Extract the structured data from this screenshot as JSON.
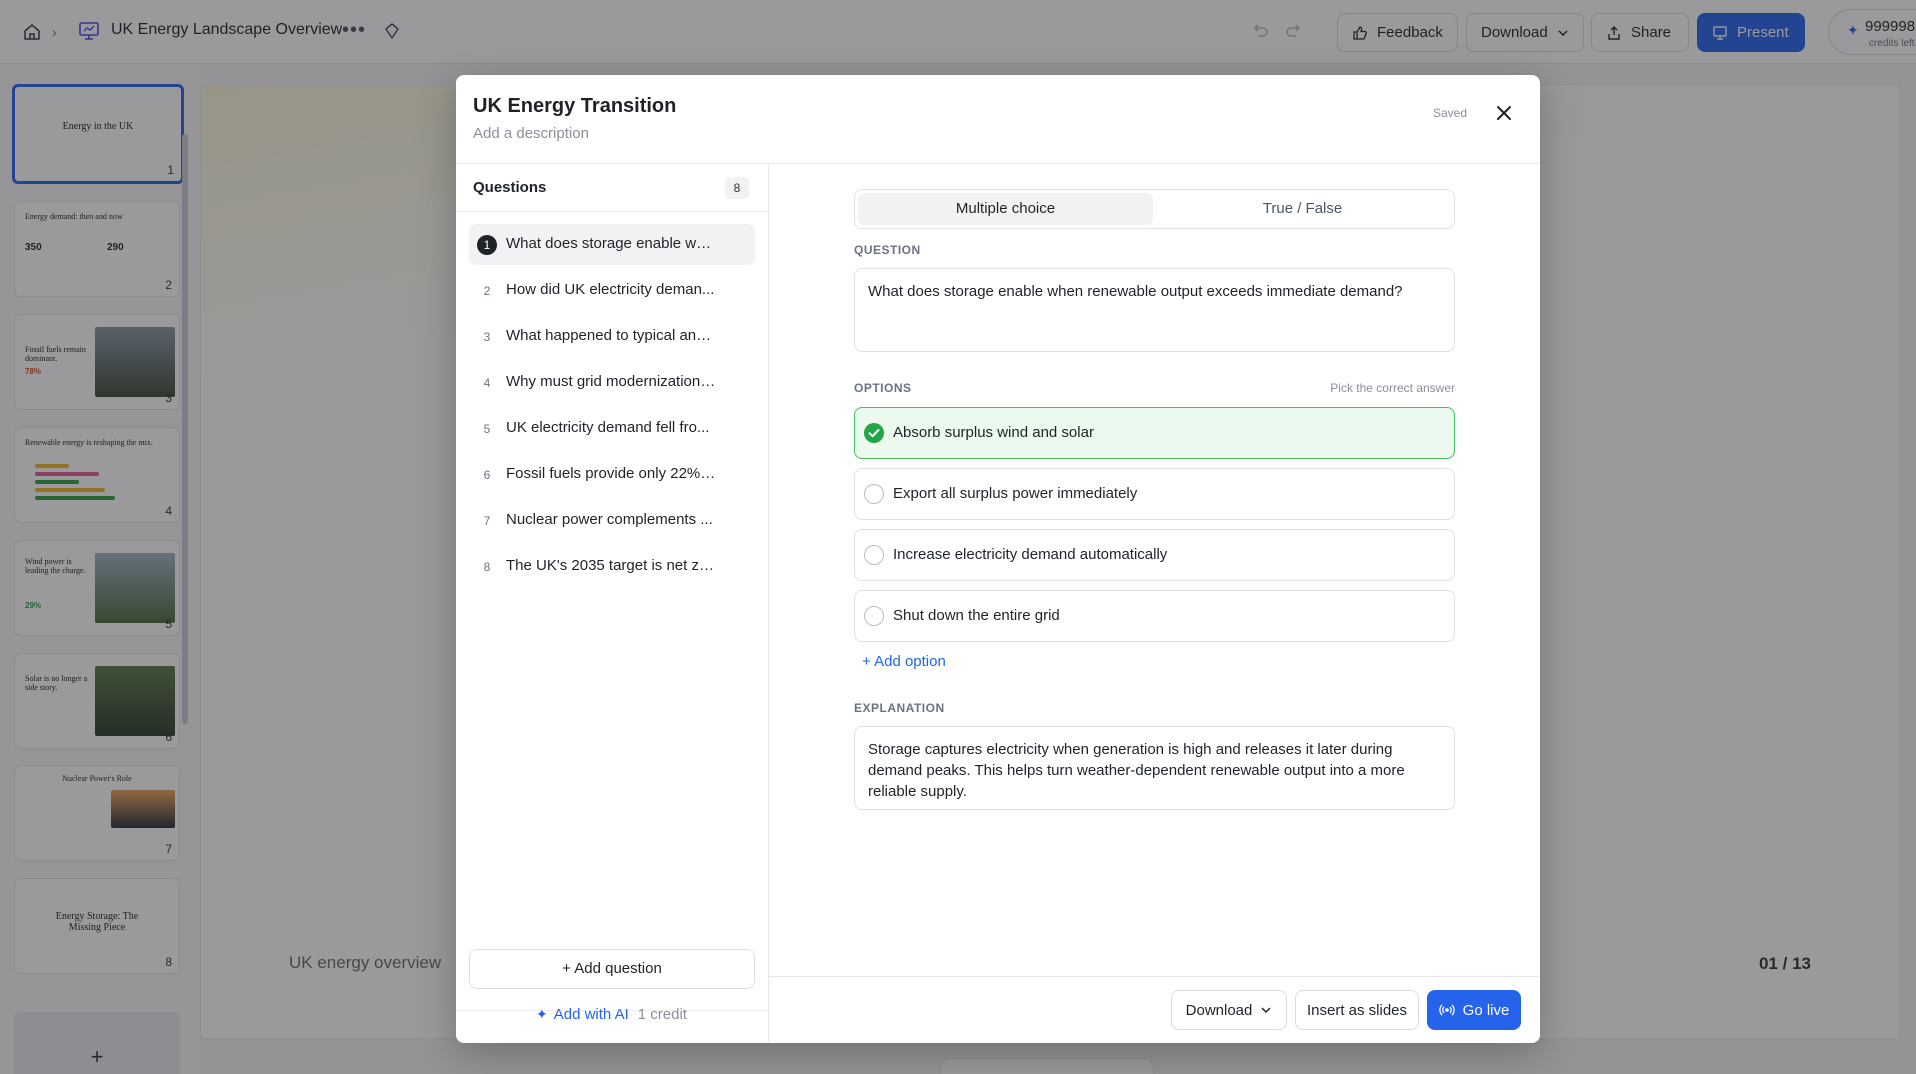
{
  "app": {
    "breadcrumb_doc_title": "UK Energy Landscape Overview",
    "toolbar": {
      "feedback_label": "Feedback",
      "download_label": "Download",
      "share_label": "Share",
      "present_label": "Present",
      "credits_value": "999998",
      "credits_label": "credits left"
    }
  },
  "thumbnails": [
    {
      "number": "1",
      "title": "Energy in the UK"
    },
    {
      "number": "2",
      "title": "Energy demand: then and now",
      "stat_a": "350",
      "stat_b": "290"
    },
    {
      "number": "3",
      "title": "Fossil fuels remain dominant.",
      "stat": "78%"
    },
    {
      "number": "4",
      "title": "Renewable energy is reshaping the mix."
    },
    {
      "number": "5",
      "title": "Wind power is leading the charge.",
      "stat": "29%"
    },
    {
      "number": "6",
      "title": "Solar is no longer a side story."
    },
    {
      "number": "7",
      "title": "Nuclear Power's Role"
    },
    {
      "number": "8",
      "title": "Energy Storage: The Missing Piece"
    }
  ],
  "canvas": {
    "footer_left": "UK energy overview",
    "page_indicator": "01 / 13"
  },
  "modal": {
    "title": "UK Energy Transition",
    "description_placeholder": "Add a description",
    "saved_status": "Saved",
    "questions_label": "Questions",
    "questions_count": "8",
    "questions": [
      {
        "number": "1",
        "text": "What does storage enable wh..."
      },
      {
        "number": "2",
        "text": "How did UK electricity deman..."
      },
      {
        "number": "3",
        "text": "What happened to typical ann..."
      },
      {
        "number": "4",
        "text": "Why must grid modernization ..."
      },
      {
        "number": "5",
        "text": "UK electricity demand fell fro..."
      },
      {
        "number": "6",
        "text": "Fossil fuels provide only 22% ..."
      },
      {
        "number": "7",
        "text": "Nuclear power complements ..."
      },
      {
        "number": "8",
        "text": "The UK's 2035 target is net ze..."
      }
    ],
    "add_question_label": "+ Add question",
    "add_with_ai_label": "Add with AI",
    "add_with_ai_cost": "1 credit",
    "type_tabs": {
      "multiple_choice": "Multiple choice",
      "true_false": "True / False"
    },
    "question_label": "QUESTION",
    "question_text": "What does storage enable when renewable output exceeds immediate demand?",
    "options_label": "OPTIONS",
    "options_hint": "Pick the correct answer",
    "options": [
      {
        "text": "Absorb surplus wind and solar",
        "correct": true
      },
      {
        "text": "Export all surplus power immediately",
        "correct": false
      },
      {
        "text": "Increase electricity demand automatically",
        "correct": false
      },
      {
        "text": "Shut down the entire grid",
        "correct": false
      }
    ],
    "add_option_label": "+ Add option",
    "explanation_label": "EXPLANATION",
    "explanation_text": "Storage captures electricity when generation is high and releases it later during demand peaks. This helps turn weather-dependent renewable output into a more reliable supply.",
    "footer": {
      "download_label": "Download",
      "insert_label": "Insert as slides",
      "go_live_label": "Go live"
    }
  },
  "colors": {
    "accent": "#2563eb",
    "correct_bg": "#ecf9ee",
    "correct_border": "#46c15e",
    "check": "#22a447"
  }
}
